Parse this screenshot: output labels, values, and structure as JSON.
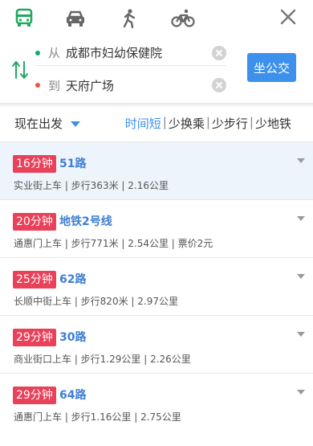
{
  "modes": [
    {
      "name": "bus",
      "icon": "bus-icon",
      "active": true
    },
    {
      "name": "car",
      "icon": "car-icon",
      "active": false
    },
    {
      "name": "walk",
      "icon": "walk-icon",
      "active": false
    },
    {
      "name": "bike",
      "icon": "bike-icon",
      "active": false
    }
  ],
  "colors": {
    "accent": "#3d90ec",
    "active_mode": "#22a860",
    "time_badge": "#e94159",
    "route_name": "#3d7fd3"
  },
  "search": {
    "from_label": "从",
    "from_value": "成都市妇幼保健院",
    "to_label": "到",
    "to_value": "天府广场",
    "go_button": "坐公交"
  },
  "filter": {
    "depart": "现在出发",
    "sorts": [
      "时间短",
      "少换乘",
      "少步行",
      "少地铁"
    ],
    "active_sort": "时间短"
  },
  "results": [
    {
      "time": "16分钟",
      "route": "51路",
      "detail": "实业街上车 | 步行363米 | 2.16公里"
    },
    {
      "time": "20分钟",
      "route": "地铁2号线",
      "detail": "通惠门上车 | 步行771米 | 2.54公里 | 票价2元"
    },
    {
      "time": "25分钟",
      "route": "62路",
      "detail": "长顺中街上车 | 步行820米 | 2.97公里"
    },
    {
      "time": "29分钟",
      "route": "30路",
      "detail": "商业街口上车 | 步行1.29公里 | 2.26公里"
    },
    {
      "time": "29分钟",
      "route": "64路",
      "detail": "通惠门上车 | 步行1.16公里 | 2.75公里"
    }
  ]
}
